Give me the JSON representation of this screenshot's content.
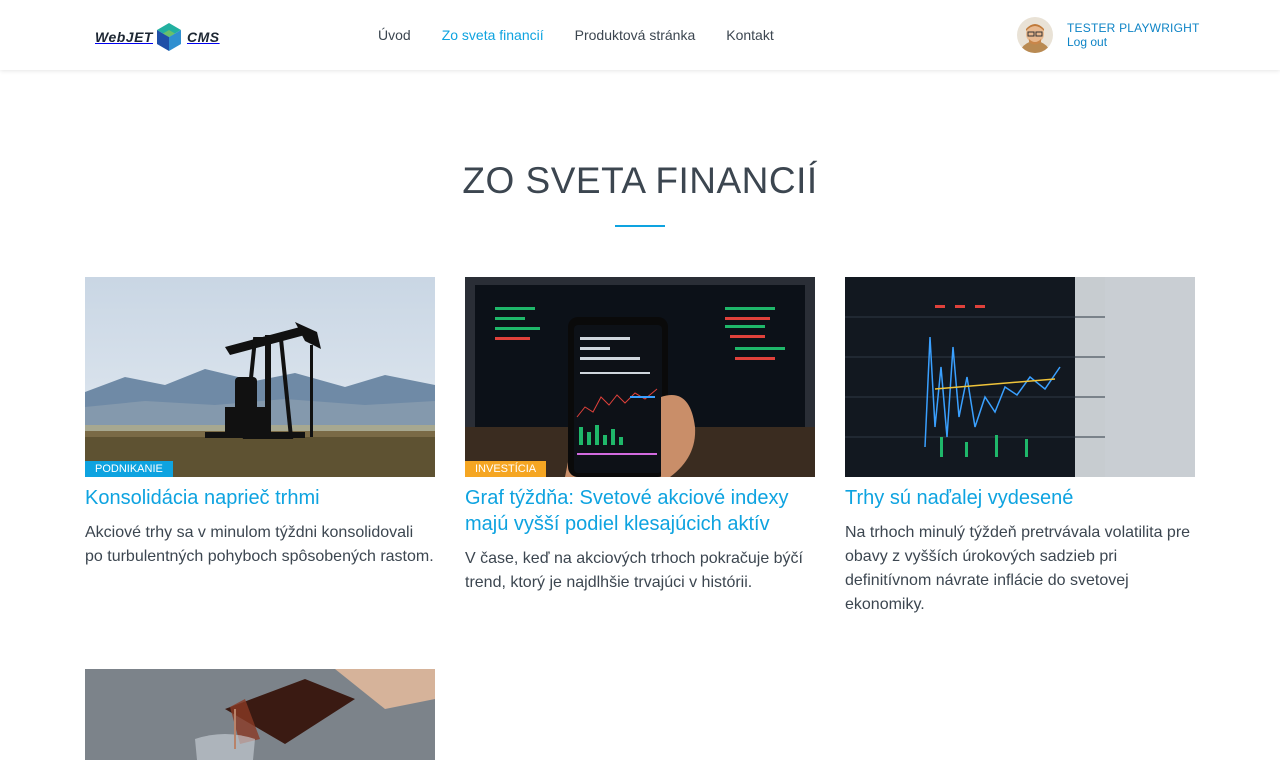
{
  "header": {
    "logo": {
      "left": "WebJET",
      "right": "CMS"
    },
    "nav": [
      {
        "label": "Úvod",
        "active": false
      },
      {
        "label": "Zo sveta financií",
        "active": true
      },
      {
        "label": "Produktová stránka",
        "active": false
      },
      {
        "label": "Kontakt",
        "active": false
      }
    ],
    "user": {
      "name": "TESTER PLAYWRIGHT",
      "logout": "Log out"
    }
  },
  "page": {
    "title": "ZO SVETA FINANCIÍ"
  },
  "articles": [
    {
      "badge": "PODNIKANIE",
      "title": "Konsolidácia naprieč trhmi",
      "text": "Akciové trhy sa v minulom týždni konsolidovali po turbulentných pohyboch spôsobených rastom."
    },
    {
      "badge": "INVESTÍCIA",
      "title": "Graf týždňa: Svetové akciové indexy majú vyšší podiel klesajúcich aktív",
      "text": "V čase, keď na akciových trhoch pokračuje býčí trend, ktorý je najdlhšie trvajúci v histórii."
    },
    {
      "badge": "",
      "title": "Trhy sú naďalej vydesené",
      "text": "Na trhoch minulý týždeň pretrvávala volatilita pre obavy z vyšších úrokových sadzieb pri definitívnom návrate inflácie do svetovej ekonomiky."
    }
  ],
  "colors": {
    "accent": "#0ea3e0",
    "badge_blue": "#0ea3e0",
    "badge_orange": "#f5a623",
    "text": "#3c4650"
  }
}
